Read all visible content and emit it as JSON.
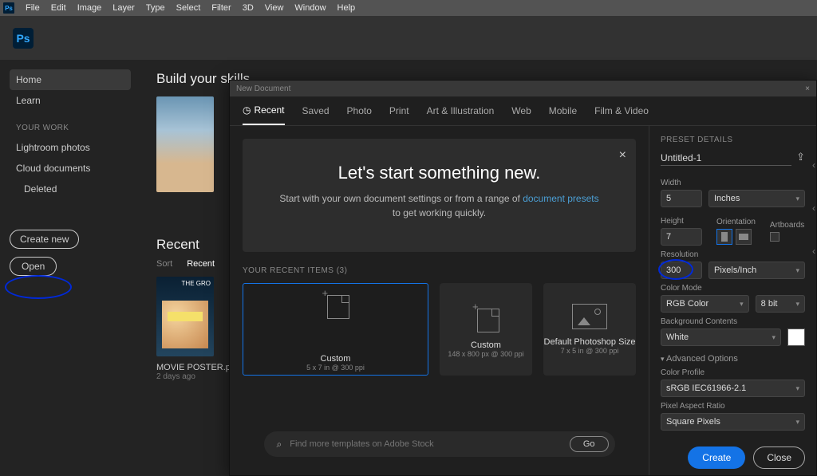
{
  "menubar": [
    "File",
    "Edit",
    "Image",
    "Layer",
    "Type",
    "Select",
    "Filter",
    "3D",
    "View",
    "Window",
    "Help"
  ],
  "logo": "Ps",
  "sidebar": {
    "home": "Home",
    "learn": "Learn",
    "your_work_hdr": "YOUR WORK",
    "lr": "Lightroom photos",
    "cloud": "Cloud documents",
    "deleted": "Deleted",
    "create_new": "Create new",
    "open": "Open"
  },
  "main": {
    "build": "Build your skills",
    "recent_h": "Recent",
    "sort": "Sort",
    "recent_tab": "Recent",
    "poster_name": "MOVIE POSTER.psd",
    "poster_time": "2 days ago"
  },
  "modal": {
    "title": "New Document",
    "tabs": [
      "Recent",
      "Saved",
      "Photo",
      "Print",
      "Art & Illustration",
      "Web",
      "Mobile",
      "Film & Video"
    ],
    "banner": {
      "h": "Let's start something new.",
      "p1": "Start with your own document settings or from a range of ",
      "link": "document presets",
      "p2": " to get working quickly."
    },
    "recent_lbl": "YOUR RECENT ITEMS  (3)",
    "cards": [
      {
        "t": "Custom",
        "s": "5 x 7 in @ 300 ppi"
      },
      {
        "t": "Custom",
        "s": "148 x 800 px @ 300 ppi"
      },
      {
        "t": "Default Photoshop Size",
        "s": "7 x 5 in @ 300 ppi"
      }
    ],
    "stock_ph": "Find more templates on Adobe Stock",
    "go": "Go"
  },
  "details": {
    "hdr": "PRESET DETAILS",
    "name": "Untitled-1",
    "width_l": "Width",
    "width_v": "5",
    "width_u": "Inches",
    "height_l": "Height",
    "height_v": "7",
    "ori_l": "Orientation",
    "art_l": "Artboards",
    "res_l": "Resolution",
    "res_v": "300",
    "res_u": "Pixels/Inch",
    "cm_l": "Color Mode",
    "cm_v": "RGB Color",
    "cm_bit": "8 bit",
    "bg_l": "Background Contents",
    "bg_v": "White",
    "adv": "Advanced Options",
    "cp_l": "Color Profile",
    "cp_v": "sRGB IEC61966-2.1",
    "par_l": "Pixel Aspect Ratio",
    "par_v": "Square Pixels",
    "create": "Create",
    "close": "Close"
  }
}
